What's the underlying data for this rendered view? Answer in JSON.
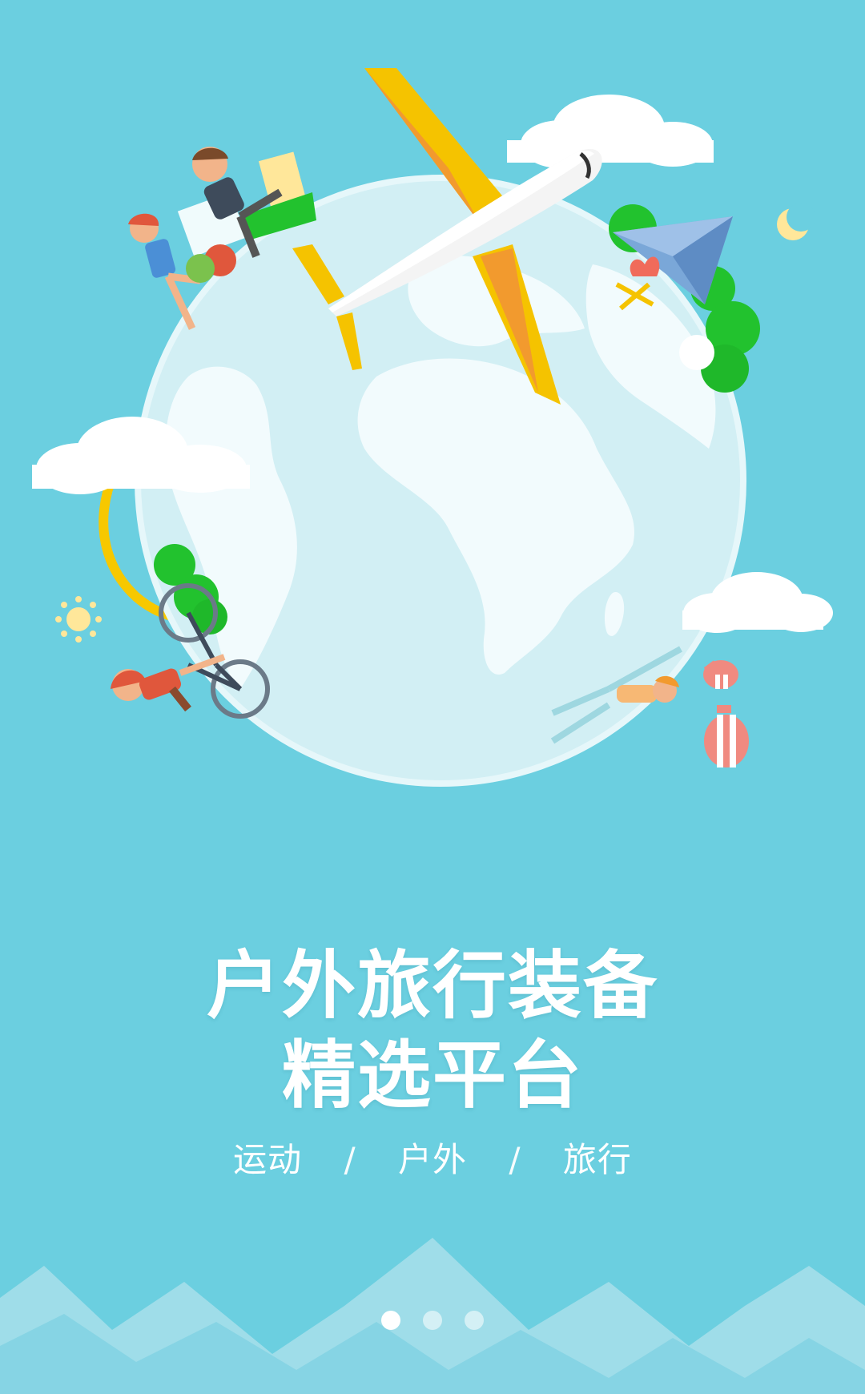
{
  "onboarding": {
    "title_line1": "户外旅行装备",
    "title_line2": "精选平台",
    "tags": [
      "运动",
      "户外",
      "旅行"
    ],
    "separator": "/",
    "page_count": 3,
    "active_page": 1
  },
  "colors": {
    "background": "#6bcfe0",
    "globe": "#d2eff4",
    "continents": "#f2fbfd",
    "plane_wing": "#f5c300",
    "plane_wing_shade": "#f29a2e",
    "plane_body": "#ffffff",
    "flight_path": "#f7c800",
    "cloud": "#ffffff",
    "tree": "#22c22e",
    "paper_plane": "#7aa7d8",
    "balloon": "#f08a80",
    "mountain_light": "#9fdde9",
    "mountain_mid": "#86d4e4"
  },
  "icons": {
    "sun": "sun-icon",
    "moon": "crescent-moon-icon",
    "paper_plane": "paper-plane-icon",
    "balloon": "hot-air-balloon-icon"
  }
}
